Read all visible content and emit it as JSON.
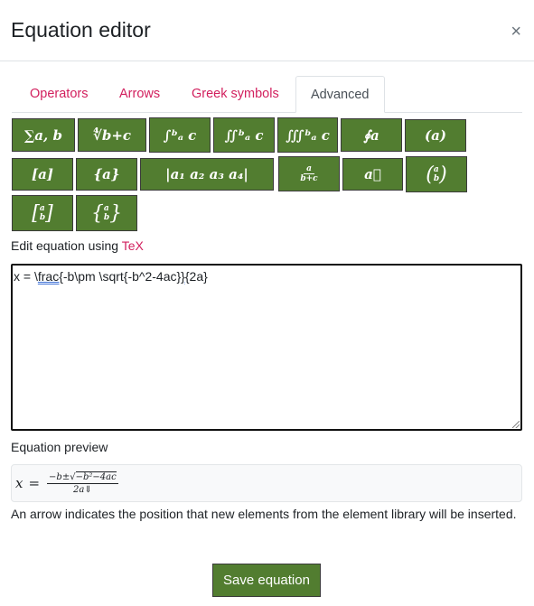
{
  "dialog": {
    "title": "Equation editor",
    "close_icon": "×"
  },
  "tabs": [
    {
      "label": "Operators",
      "active": false
    },
    {
      "label": "Arrows",
      "active": false
    },
    {
      "label": "Greek symbols",
      "active": false
    },
    {
      "label": "Advanced",
      "active": true
    }
  ],
  "elements": [
    {
      "label": "∑a, b",
      "name": "sum"
    },
    {
      "label": "∜b+c",
      "name": "nth-root"
    },
    {
      "label": "∫ᵇₐ c",
      "name": "integral"
    },
    {
      "label": "∬ᵇₐ c",
      "name": "double-integral"
    },
    {
      "label": "∭ᵇₐ c",
      "name": "triple-integral"
    },
    {
      "label": "∮a",
      "name": "contour-integral"
    },
    {
      "label": "(a)",
      "name": "parentheses"
    },
    {
      "label": "[a]",
      "name": "brackets"
    },
    {
      "label": "{a}",
      "name": "braces"
    },
    {
      "label": "|a₁   a₂ a₃   a₄|",
      "name": "determinant"
    },
    {
      "label_num": "a",
      "label_den": "b+c",
      "name": "fraction"
    },
    {
      "label": "a⃗",
      "name": "vector"
    },
    {
      "label_top": "a",
      "label_bottom": "b",
      "open": "(",
      "close": ")",
      "name": "binomial"
    },
    {
      "label_top": "a",
      "label_bottom": "b",
      "open": "[",
      "close": "]",
      "name": "bracket-matrix"
    },
    {
      "label_top": "a",
      "label_bottom": "b",
      "open": "{",
      "close": "}",
      "name": "brace-matrix"
    }
  ],
  "editor": {
    "label_prefix": "Edit equation using ",
    "label_link": "TeX",
    "value_parts": [
      "x = \\",
      "frac{",
      "-b\\pm \\sqrt{-b^2-4ac}",
      "}{",
      "2a}"
    ]
  },
  "preview": {
    "label": "Equation preview",
    "lhs": "x",
    "eq": "=",
    "numerator_pre": "−b±√",
    "numerator_rad": "−b²−4ac",
    "denominator": "2a⇓"
  },
  "help_text": "An arrow indicates the position that new elements from the element library will be inserted.",
  "save_button": "Save equation"
}
